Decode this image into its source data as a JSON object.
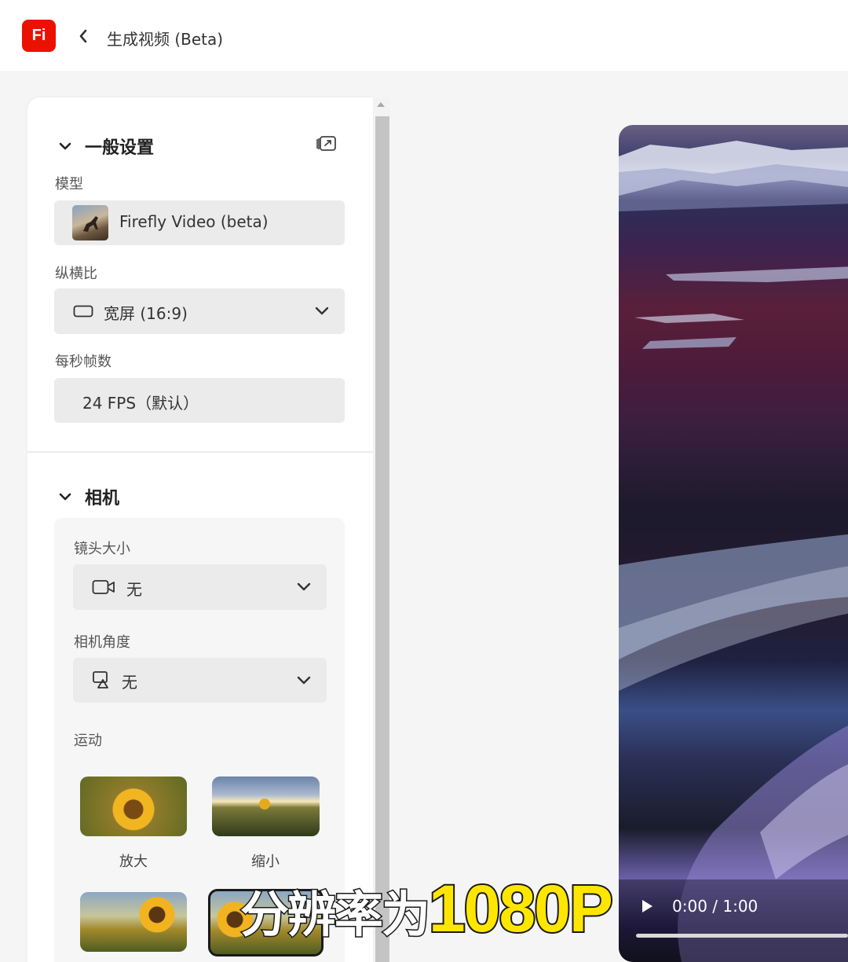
{
  "app": {
    "logo_text": "Fi",
    "title": "生成视频 (Beta)"
  },
  "general": {
    "header": "一般设置",
    "model_label": "模型",
    "model_value": "Firefly Video (beta)",
    "aspect_label": "纵横比",
    "aspect_value": "宽屏 (16:9)",
    "fps_label": "每秒帧数",
    "fps_value": "24 FPS（默认）"
  },
  "camera": {
    "header": "相机",
    "shot_label": "镜头大小",
    "shot_value": "无",
    "angle_label": "相机角度",
    "angle_value": "无",
    "motion_label": "运动",
    "motions": [
      {
        "label": "放大"
      },
      {
        "label": "缩小"
      }
    ]
  },
  "video": {
    "time": "0:00 / 1:00",
    "progress": 0
  },
  "subtitle": {
    "cn": "分辨率为",
    "en": "1080P"
  },
  "colors": {
    "brand": "#eb1000",
    "subtitle_highlight": "#ffe600"
  }
}
